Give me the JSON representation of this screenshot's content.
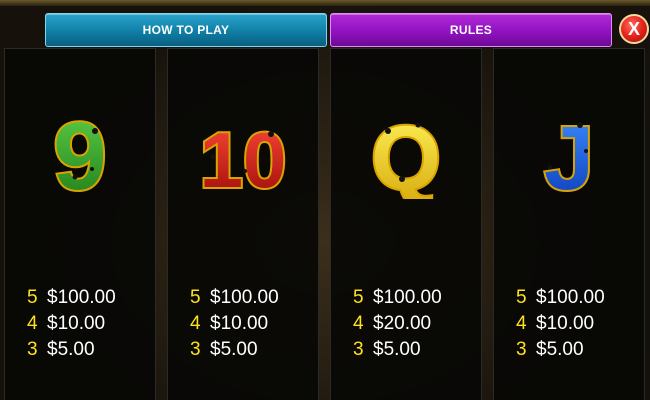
{
  "tabs": {
    "how_to_play": "HOW TO PLAY",
    "rules": "RULES"
  },
  "close_label": "X",
  "symbols": [
    {
      "glyph": "9",
      "fill_top": "#5fd048",
      "fill_bottom": "#1d7a18",
      "pays": [
        {
          "count": "5",
          "value": "$100.00"
        },
        {
          "count": "4",
          "value": "$10.00"
        },
        {
          "count": "3",
          "value": "$5.00"
        }
      ]
    },
    {
      "glyph": "10",
      "fill_top": "#ff4a3a",
      "fill_bottom": "#9a0a06",
      "pays": [
        {
          "count": "5",
          "value": "$100.00"
        },
        {
          "count": "4",
          "value": "$10.00"
        },
        {
          "count": "3",
          "value": "$5.00"
        }
      ]
    },
    {
      "glyph": "Q",
      "fill_top": "#fff35a",
      "fill_bottom": "#d6a80a",
      "pays": [
        {
          "count": "5",
          "value": "$100.00"
        },
        {
          "count": "4",
          "value": "$20.00"
        },
        {
          "count": "3",
          "value": "$5.00"
        }
      ]
    },
    {
      "glyph": "J",
      "fill_top": "#3d8cff",
      "fill_bottom": "#0a3ab8",
      "pays": [
        {
          "count": "5",
          "value": "$100.00"
        },
        {
          "count": "4",
          "value": "$10.00"
        },
        {
          "count": "3",
          "value": "$5.00"
        }
      ]
    }
  ],
  "colors": {
    "pay_count": "#ffe21a",
    "pay_value": "#ffffff",
    "symbol_outline": "#d9a400"
  }
}
